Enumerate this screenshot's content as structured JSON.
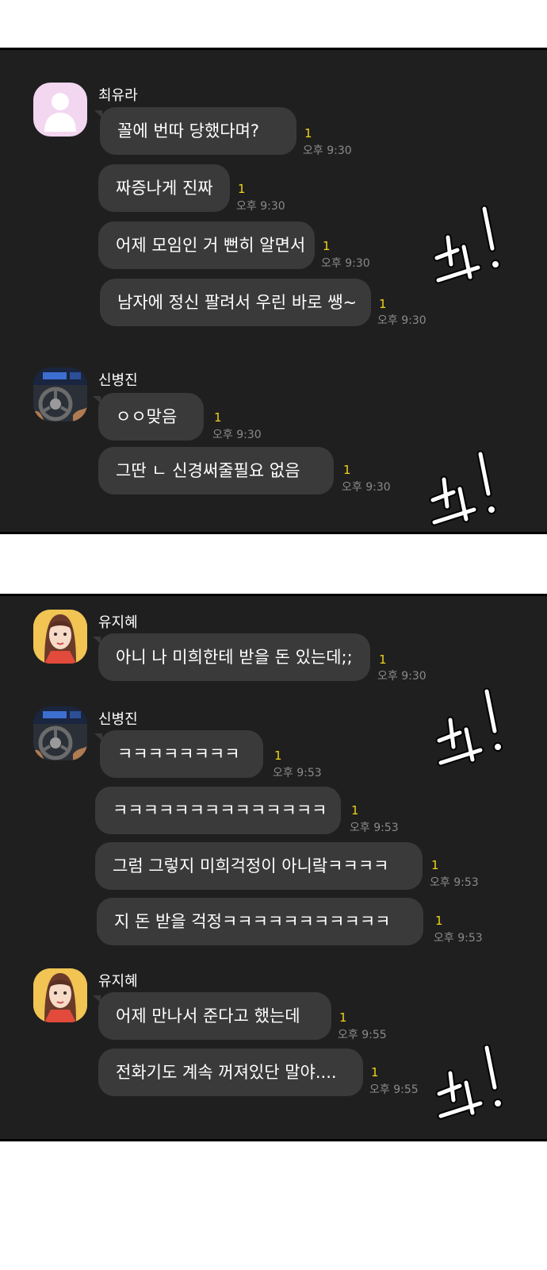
{
  "panel1": {
    "groups": [
      {
        "sender": "최유라",
        "avatar": "default-profile-icon",
        "messages": [
          {
            "text": "꼴에 번따 당했다며?",
            "unread": "1",
            "time": "오후 9:30"
          },
          {
            "text": "짜증나게 진짜",
            "unread": "1",
            "time": "오후 9:30"
          },
          {
            "text": "어제 모임인 거 뻔히 알면서",
            "unread": "1",
            "time": "오후 9:30"
          },
          {
            "text": "남자에 정신 팔려서 우린 바로 쌩~",
            "unread": "1",
            "time": "오후 9:30"
          }
        ]
      },
      {
        "sender": "신병진",
        "avatar": "car-steering-wheel-avatar",
        "messages": [
          {
            "text": "ㅇㅇ맞음",
            "unread": "1",
            "time": "오후 9:30"
          },
          {
            "text": "그딴 ㄴ 신경써줄필요 없음",
            "unread": "1",
            "time": "오후 9:30"
          }
        ]
      }
    ]
  },
  "panel2": {
    "groups": [
      {
        "sender": "유지혜",
        "avatar": "girl-portrait-avatar",
        "messages": [
          {
            "text": "아니 나 미희한테 받을 돈 있는데;;",
            "unread": "1",
            "time": "오후 9:30"
          }
        ]
      },
      {
        "sender": "신병진",
        "avatar": "car-steering-wheel-avatar",
        "messages": [
          {
            "text": "ㅋㅋㅋㅋㅋㅋㅋㅋ",
            "unread": "1",
            "time": "오후 9:53"
          },
          {
            "text": "ㅋㅋㅋㅋㅋㅋㅋㅋㅋㅋㅋㅋㅋㅋ",
            "unread": "1",
            "time": "오후 9:53"
          },
          {
            "text": "그럼 그렇지 미희걱정이 아니랔ㅋㅋㅋㅋ",
            "unread": "1",
            "time": "오후 9:53"
          },
          {
            "text": "지 돈 받을 걱정ㅋㅋㅋㅋㅋㅋㅋㅋㅋㅋㅋ",
            "unread": "1",
            "time": "오후 9:53"
          }
        ]
      },
      {
        "sender": "유지혜",
        "avatar": "girl-portrait-avatar",
        "messages": [
          {
            "text": "어제 만나서 준다고 했는데",
            "unread": "1",
            "time": "오후 9:55"
          },
          {
            "text": "전화기도 계속 꺼져있단 말야....",
            "unread": "1",
            "time": "오후 9:55"
          }
        ]
      }
    ]
  },
  "colors": {
    "panel": "#1f1f1f",
    "bubble": "#3a3a3a",
    "unread": "#f0d21a",
    "time": "#8a8a8a"
  }
}
